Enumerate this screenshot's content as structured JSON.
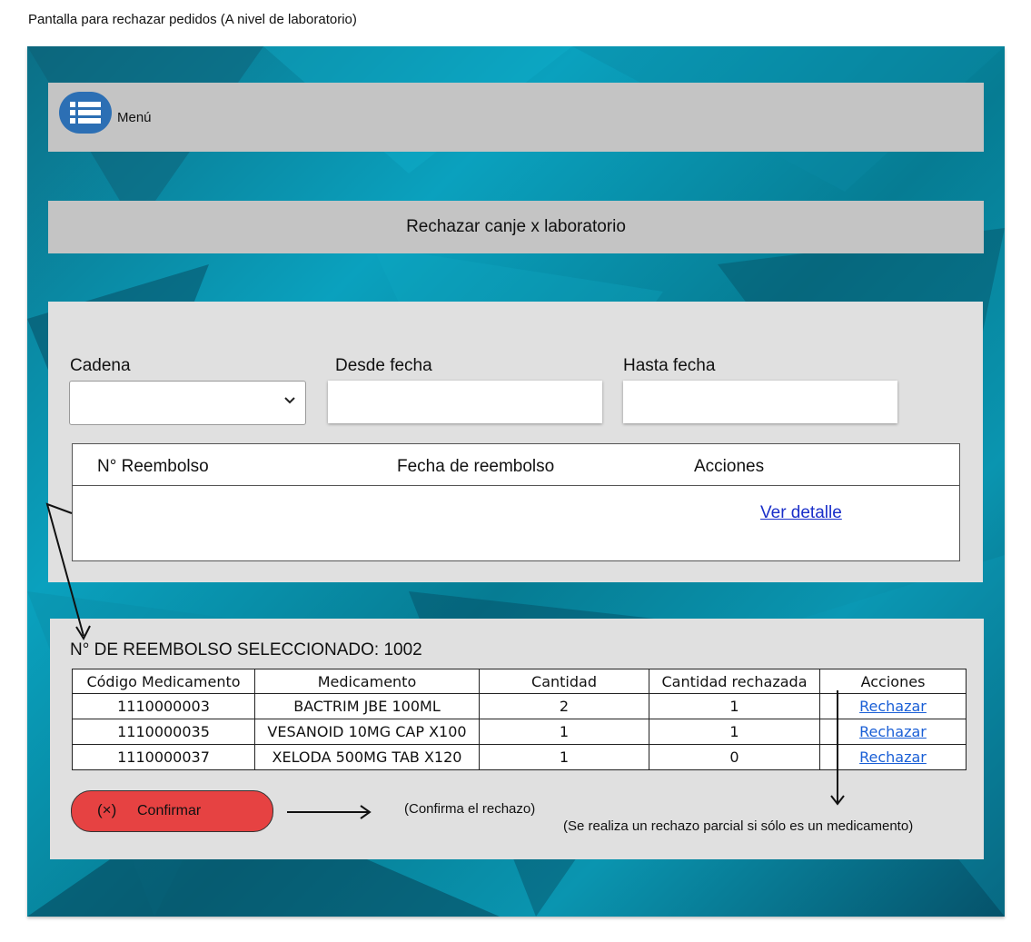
{
  "caption": "Pantalla para rechazar pedidos (A nivel de laboratorio)",
  "menu": {
    "label": "Menú",
    "icon": "list-menu-icon"
  },
  "title": "Rechazar canje x laboratorio",
  "filters": {
    "cadena_label": "Cadena",
    "cadena_value": "",
    "desde_label": "Desde fecha",
    "desde_value": "",
    "hasta_label": "Hasta fecha",
    "hasta_value": ""
  },
  "reembolsos": {
    "headers": [
      "N° Reembolso",
      "Fecha de reembolso",
      "Acciones"
    ],
    "action_link": "Ver detalle"
  },
  "detalle": {
    "title": "N° DE REEMBOLSO SELECCIONADO: 1002",
    "headers": [
      "Código Medicamento",
      "Medicamento",
      "Cantidad",
      "Cantidad rechazada",
      "Acciones"
    ],
    "rows": [
      {
        "codigo": "1110000003",
        "medicamento": "BACTRIM JBE 100ML",
        "cantidad": "2",
        "rechazada": "1",
        "accion": "Rechazar"
      },
      {
        "codigo": "1110000035",
        "medicamento": "VESANOID 10MG CAP X100",
        "cantidad": "1",
        "rechazada": "1",
        "accion": "Rechazar"
      },
      {
        "codigo": "1110000037",
        "medicamento": "XELODA 500MG TAB X120",
        "cantidad": "1",
        "rechazada": "0",
        "accion": "Rechazar"
      }
    ]
  },
  "confirm": {
    "icon": "(×)",
    "label": "Confirmar"
  },
  "notes": {
    "confirm_note": "(Confirma el rechazo)",
    "partial_note": "(Se realiza un rechazo parcial si sólo es un medicamento)"
  },
  "colors": {
    "panel": "#e0e0e0",
    "bar": "#c4c4c4",
    "confirm": "#e64242",
    "menu_icon": "#2c6fb4",
    "link": "#1a2fc9"
  }
}
